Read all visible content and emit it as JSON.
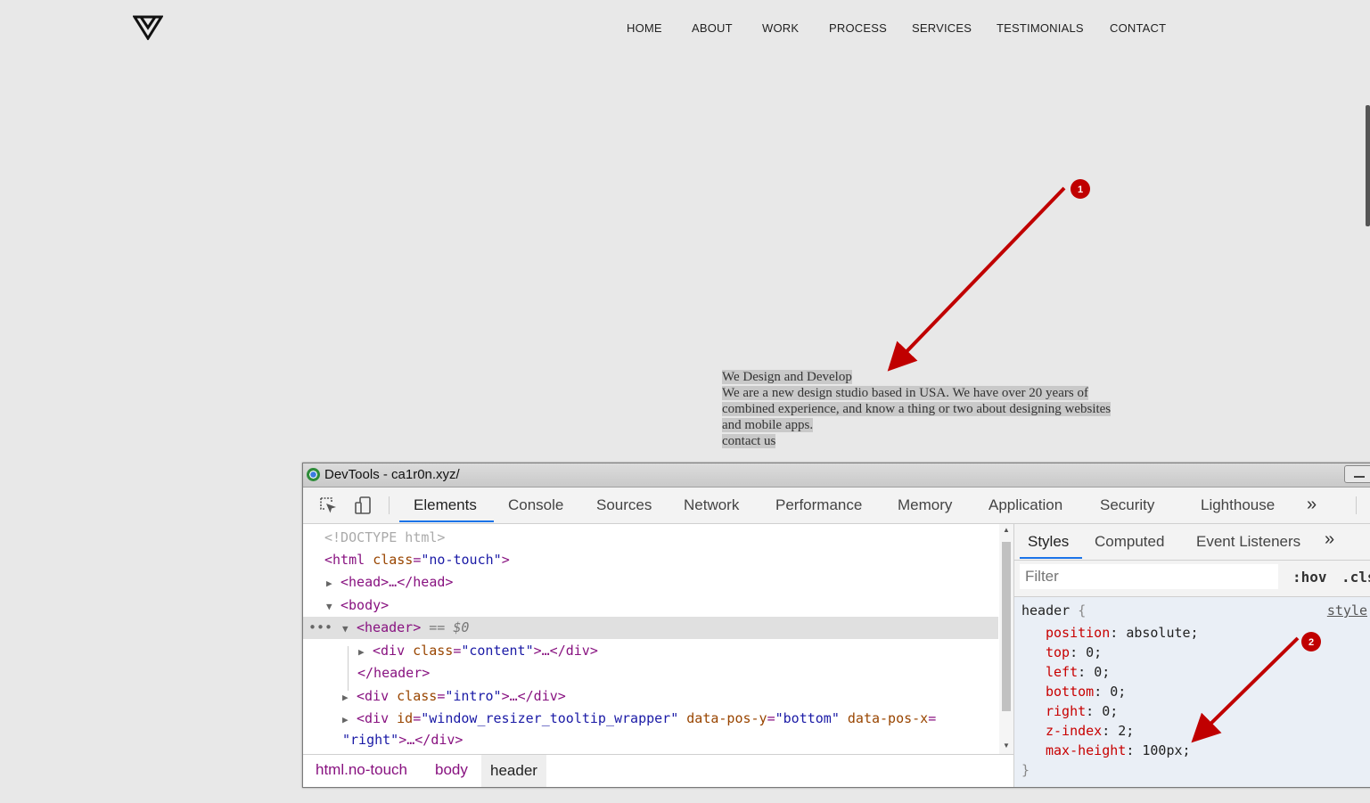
{
  "site": {
    "nav": [
      "HOME",
      "ABOUT",
      "WORK",
      "PROCESS",
      "SERVICES",
      "TESTIMONIALS",
      "CONTACT"
    ],
    "intro": {
      "heading": "We Design and Develop",
      "lines": [
        "We are a new design studio based in USA. We have over 20 years of",
        "combined experience, and know a thing or two about designing websites",
        "and mobile apps."
      ],
      "link": "contact us"
    }
  },
  "annotations": {
    "one": "1",
    "two": "2"
  },
  "devtools": {
    "title": "DevTools - ca1r0n.xyz/",
    "tabs": [
      "Elements",
      "Console",
      "Sources",
      "Network",
      "Performance",
      "Memory",
      "Application",
      "Security",
      "Lighthouse"
    ],
    "more": "»",
    "elements": {
      "doctype": "<!DOCTYPE html>",
      "html_tag": "<html",
      "html_attr": "class",
      "html_val": "\"no-touch\"",
      "head": "<head>…</head>",
      "body": "<body>",
      "header_tag": "<header>",
      "header_marker": "== $0",
      "content_tag": "<div",
      "content_attr": "class",
      "content_val": "\"content\"",
      "content_close": ">…</div>",
      "header_close": "</header>",
      "intro_tag": "<div",
      "intro_attr": "class",
      "intro_val": "\"intro\"",
      "intro_close": ">…</div>",
      "resizer_tag": "<div",
      "resizer_attr1": "id",
      "resizer_val1": "\"window_resizer_tooltip_wrapper\"",
      "resizer_attr2": "data-pos-y",
      "resizer_val2": "\"bottom\"",
      "resizer_attr3": "data-pos-x",
      "resizer_val3": "\"right\"",
      "resizer_close": ">…</div>",
      "ellipsis": "…"
    },
    "breadcrumbs": [
      "html.no-touch",
      "body",
      "header"
    ],
    "styles": {
      "tabs": [
        "Styles",
        "Computed",
        "Event Listeners"
      ],
      "more": "»",
      "filter_placeholder": "Filter",
      "hov": ":hov",
      "cls": ".cls",
      "selector": "header",
      "source": "style",
      "declarations": [
        {
          "prop": "position",
          "value": "absolute;"
        },
        {
          "prop": "top",
          "value": "0;"
        },
        {
          "prop": "left",
          "value": "0;"
        },
        {
          "prop": "bottom",
          "value": "0;"
        },
        {
          "prop": "right",
          "value": "0;"
        },
        {
          "prop": "z-index",
          "value": "2;"
        },
        {
          "prop": "max-height",
          "value": "100px;"
        }
      ]
    }
  }
}
